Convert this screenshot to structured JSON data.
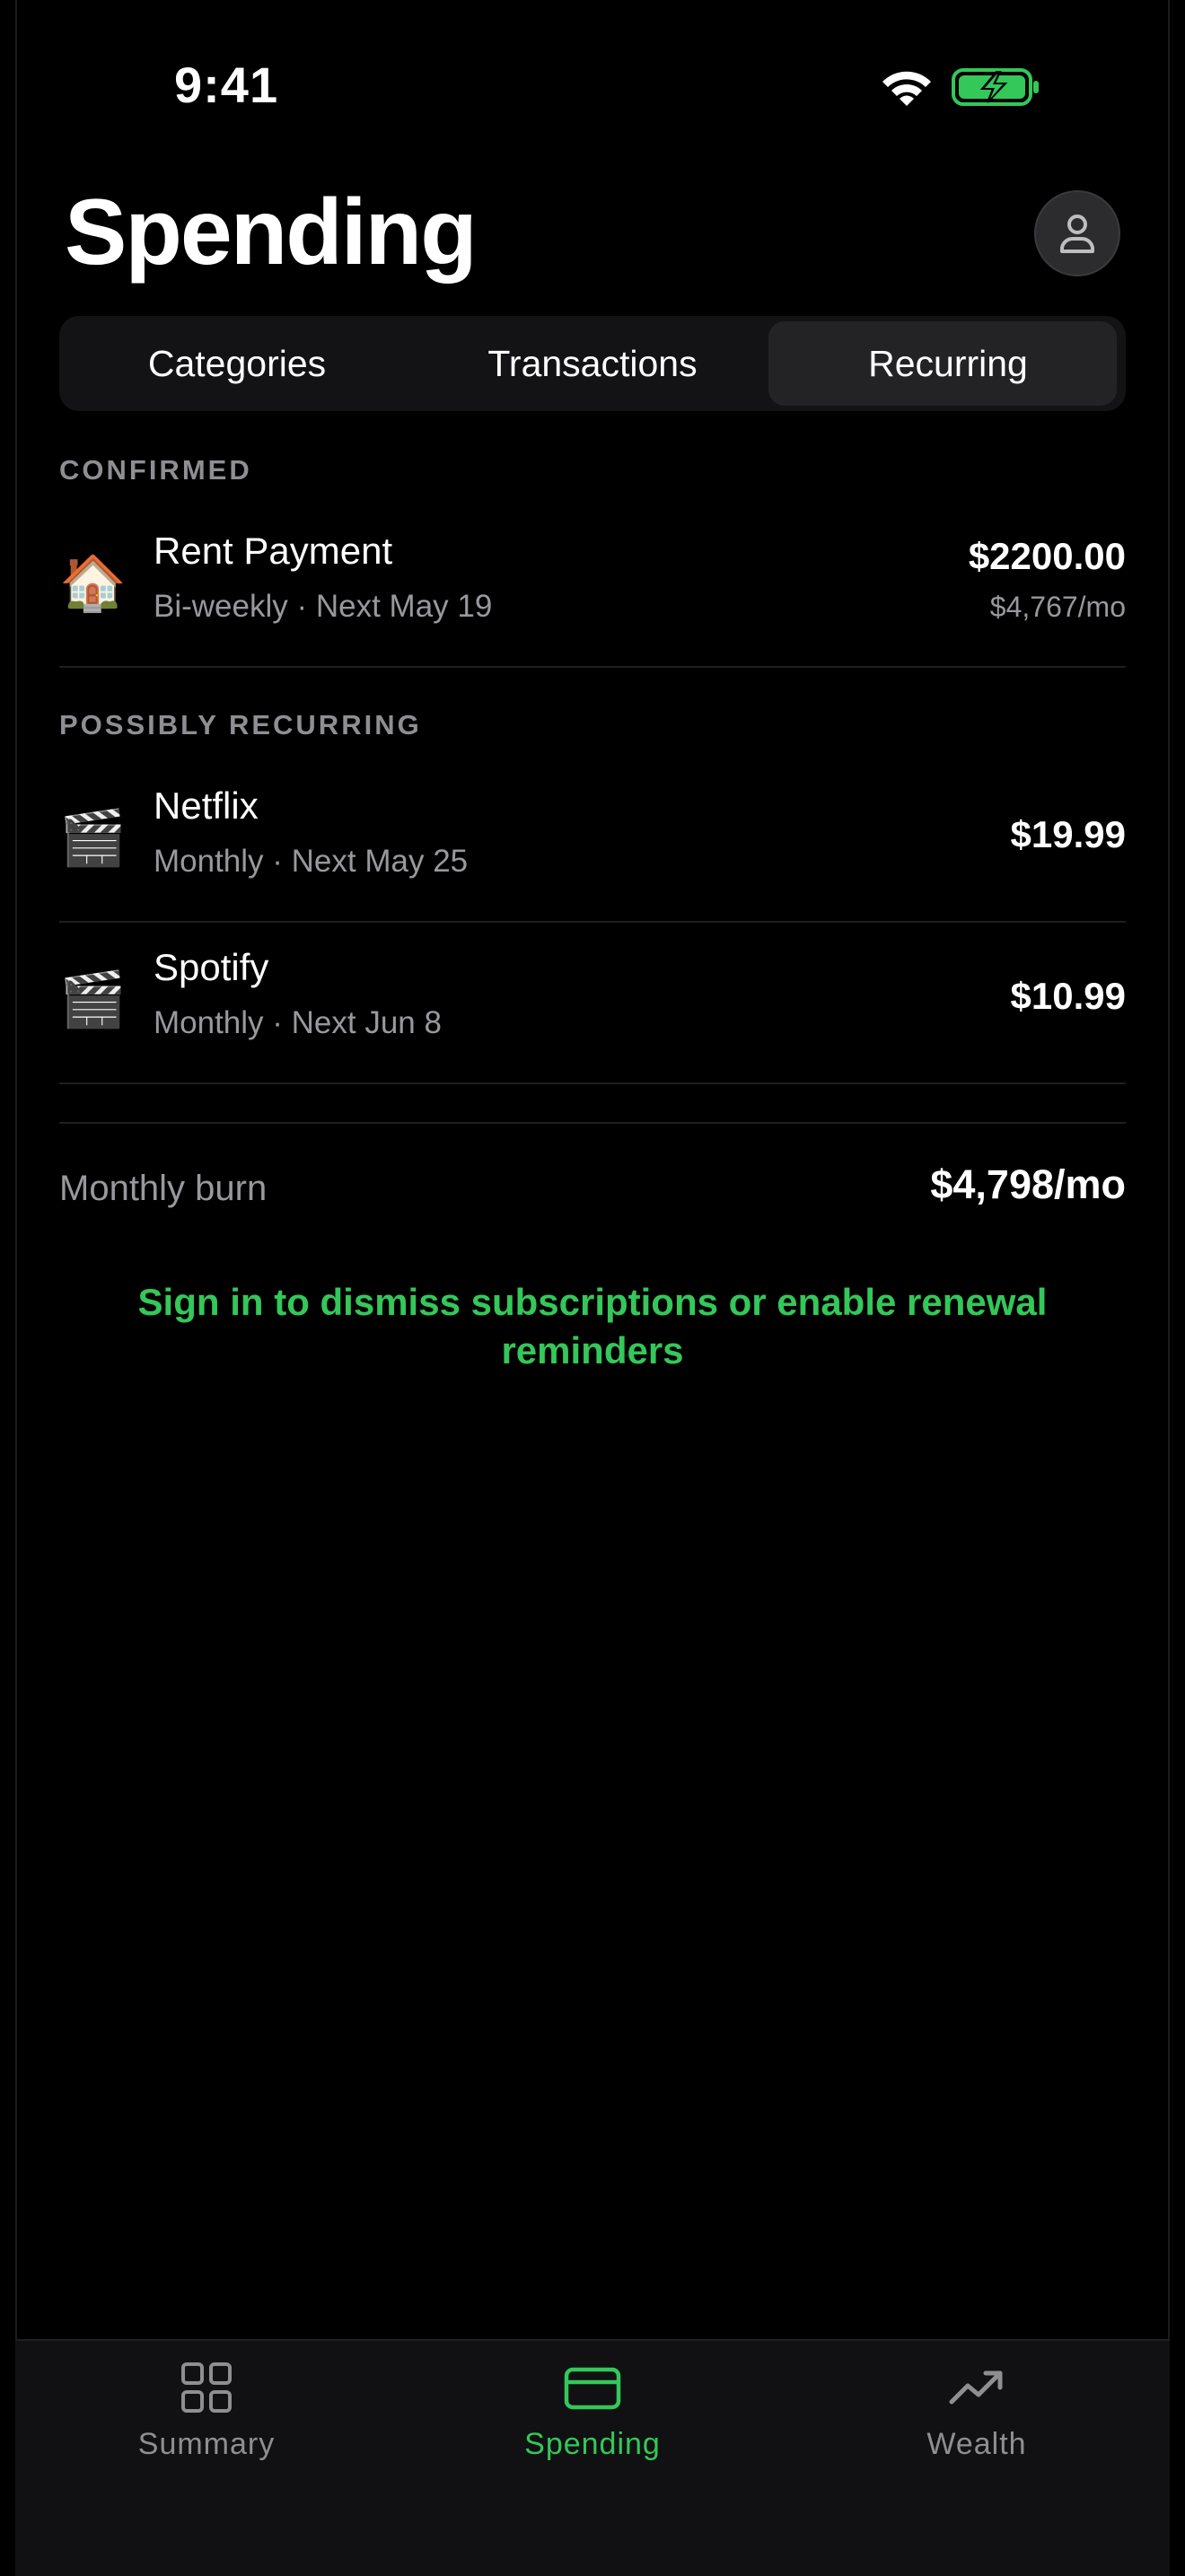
{
  "status_bar": {
    "time": "9:41"
  },
  "header": {
    "title": "Spending"
  },
  "segments": [
    {
      "label": "Categories"
    },
    {
      "label": "Transactions"
    },
    {
      "label": "Recurring"
    }
  ],
  "active_segment": "Recurring",
  "sections": {
    "confirmed": {
      "label": "CONFIRMED",
      "items": [
        {
          "icon": "house-icon",
          "emoji": "🏠",
          "name": "Rent Payment",
          "sub": "Bi-weekly · Next May 19",
          "amount": "$2200.00",
          "per_month": "$4,767/mo"
        }
      ]
    },
    "possibly": {
      "label": "POSSIBLY RECURRING",
      "items": [
        {
          "icon": "clapper-board-icon",
          "emoji": "🎬",
          "name": "Netflix",
          "sub": "Monthly · Next May 25",
          "amount": "$19.99"
        },
        {
          "icon": "clapper-board-icon",
          "emoji": "🎬",
          "name": "Spotify",
          "sub": "Monthly · Next Jun 8",
          "amount": "$10.99"
        }
      ]
    }
  },
  "summary": {
    "label": "Monthly burn",
    "value": "$4,798/mo"
  },
  "signin_note": "Sign in to dismiss subscriptions or enable renewal reminders",
  "tabbar": [
    {
      "label": "Summary",
      "icon": "grid-icon"
    },
    {
      "label": "Spending",
      "icon": "card-icon"
    },
    {
      "label": "Wealth",
      "icon": "trend-up-icon"
    }
  ],
  "active_tab": "Spending",
  "colors": {
    "accent": "#34c759",
    "background": "#000000",
    "secondary_text": "#98989d"
  }
}
